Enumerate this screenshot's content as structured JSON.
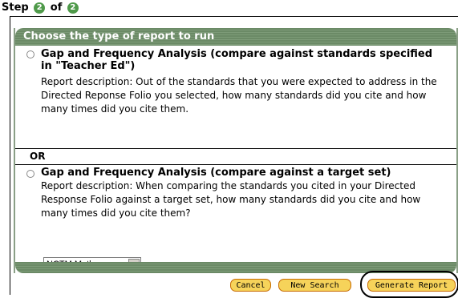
{
  "step": {
    "prefix": "Step",
    "current": "2",
    "of": "of",
    "total": "2"
  },
  "panel": {
    "title": "Choose the type of report to run",
    "options": [
      {
        "title": "Gap and Frequency Analysis (compare against standards specified in \"Teacher Ed\")",
        "description": "Report description: Out of the standards that you were expected to address in the Directed Reponse Folio you selected, how many standards did you cite and how many times did you cite them."
      },
      {
        "title": "Gap and Frequency Analysis (compare against a target set)",
        "description": "Report description: When comparing the standards you cited in your Directed Response Folio against a target set, how many standards did you cite and how many times did you cite them?"
      }
    ],
    "or_label": "OR",
    "target_select": {
      "value": "NCTM Math"
    }
  },
  "buttons": {
    "cancel": "Cancel",
    "new_search": "New Search",
    "generate": "Generate Report"
  }
}
